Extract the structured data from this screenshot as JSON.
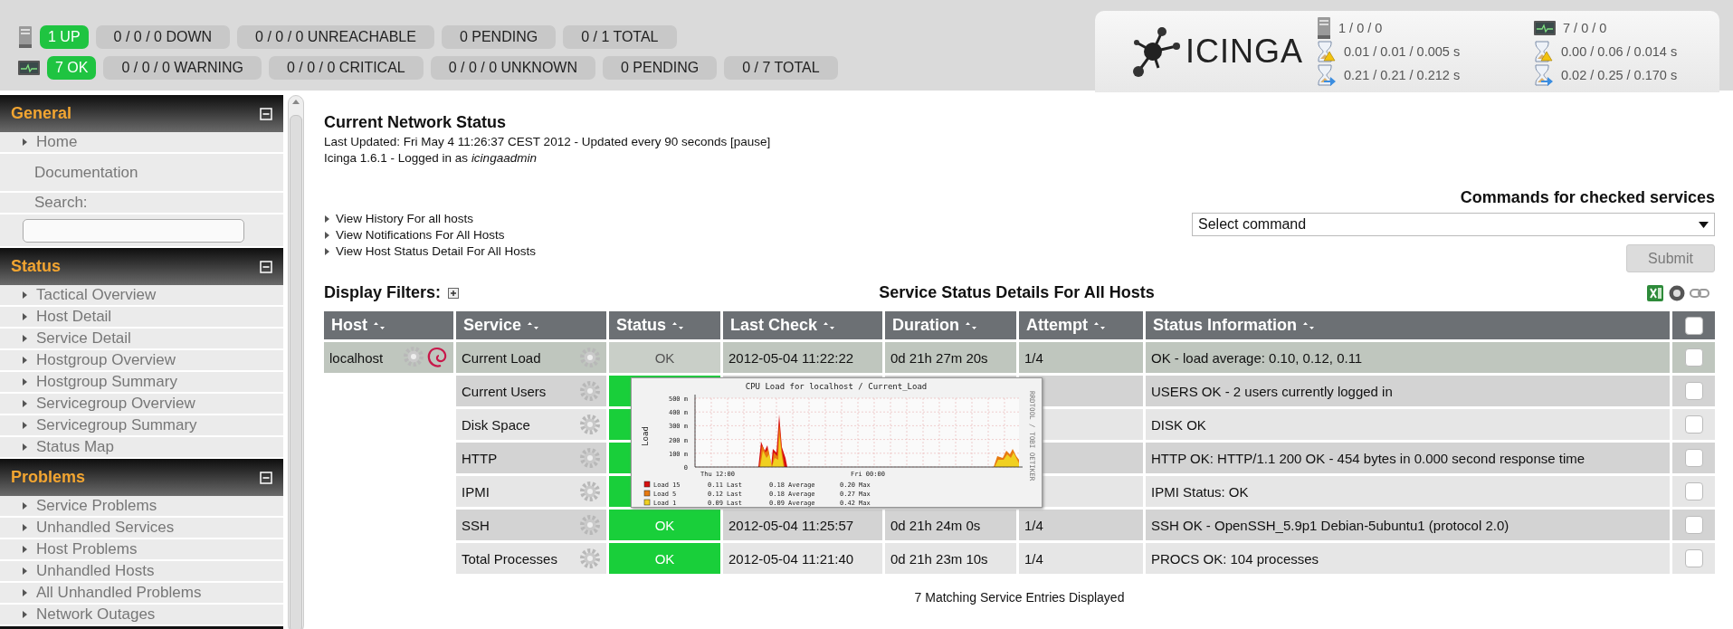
{
  "host_summary": {
    "items": [
      {
        "text": "1 UP",
        "kind": "up"
      },
      {
        "text": "0 / 0 / 0 DOWN",
        "kind": "neutral"
      },
      {
        "text": "0 / 0 / 0 UNREACHABLE",
        "kind": "neutral"
      },
      {
        "text": "0 PENDING",
        "kind": "neutral"
      },
      {
        "text": "0 / 1 TOTAL",
        "kind": "neutral"
      }
    ]
  },
  "service_summary": {
    "items": [
      {
        "text": "7 OK",
        "kind": "up"
      },
      {
        "text": "0 / 0 / 0 WARNING",
        "kind": "neutral"
      },
      {
        "text": "0 / 0 / 0 CRITICAL",
        "kind": "neutral"
      },
      {
        "text": "0 / 0 / 0 UNKNOWN",
        "kind": "neutral"
      },
      {
        "text": "0 PENDING",
        "kind": "neutral"
      },
      {
        "text": "0 / 7 TOTAL",
        "kind": "neutral"
      }
    ]
  },
  "logo": {
    "text": "ICINGA"
  },
  "performance": {
    "hosts": [
      "1 / 0 / 0",
      "0.01 / 0.01 / 0.005 s",
      "0.21 / 0.21 / 0.212 s"
    ],
    "services": [
      "7 / 0 / 0",
      "0.00 / 0.06 / 0.014 s",
      "0.02 / 0.25 / 0.170 s"
    ]
  },
  "sidebar": {
    "sections": [
      {
        "title": "General",
        "items": [
          {
            "label": "Home",
            "kind": "link"
          },
          {
            "label": "Documentation",
            "kind": "plain"
          },
          {
            "label": "Search:",
            "kind": "search"
          }
        ]
      },
      {
        "title": "Status",
        "items": [
          {
            "label": "Tactical Overview",
            "kind": "link"
          },
          {
            "label": "Host Detail",
            "kind": "link"
          },
          {
            "label": "Service Detail",
            "kind": "link"
          },
          {
            "label": "Hostgroup Overview",
            "kind": "link"
          },
          {
            "label": "Hostgroup Summary",
            "kind": "link"
          },
          {
            "label": "Servicegroup Overview",
            "kind": "link"
          },
          {
            "label": "Servicegroup Summary",
            "kind": "link"
          },
          {
            "label": "Status Map",
            "kind": "link"
          }
        ]
      },
      {
        "title": "Problems",
        "items": [
          {
            "label": "Service Problems",
            "kind": "link"
          },
          {
            "label": "Unhandled Services",
            "kind": "link"
          },
          {
            "label": "Host Problems",
            "kind": "link"
          },
          {
            "label": "Unhandled Hosts",
            "kind": "link"
          },
          {
            "label": "All Unhandled Problems",
            "kind": "link"
          },
          {
            "label": "Network Outages",
            "kind": "link"
          }
        ]
      }
    ]
  },
  "header": {
    "title": "Current Network Status",
    "last_updated": "Last Updated: Fri May 4 11:26:37 CEST 2012 - Updated every 90 seconds",
    "pause_link": "[pause]",
    "login": "Icinga 1.6.1 - Logged in as *icingaadmin*"
  },
  "links": [
    "View History For all hosts",
    "View Notifications For All Hosts",
    "View Host Status Detail For All Hosts"
  ],
  "commands": {
    "title": "Commands for checked services",
    "select": "Select command",
    "submit": {
      "label": "Submit",
      "disabled": true
    }
  },
  "filters": {
    "label": "Display Filters:"
  },
  "table": {
    "title": "Service Status Details For All Hosts",
    "columns": [
      "Host",
      "Service",
      "Status",
      "Last Check",
      "Duration",
      "Attempt",
      "Status Information"
    ],
    "header_checked": false,
    "rows": [
      {
        "host": "localhost",
        "service": "Current Load",
        "status": "OK",
        "last_check": "2012-05-04 11:22:22",
        "duration": "0d 21h 27m 20s",
        "attempt": "1/4",
        "info": "OK - load average: 0.10, 0.12, 0.11",
        "checked": false,
        "selected": true
      },
      {
        "service": "Current Users",
        "info": "USERS OK - 2 users currently logged in",
        "checked": false,
        "selected": false
      },
      {
        "service": "Disk Space",
        "info": "DISK OK",
        "checked": false,
        "selected": false
      },
      {
        "service": "HTTP",
        "info": "HTTP OK: HTTP/1.1 200 OK - 454 bytes in 0.000 second response time",
        "checked": false,
        "selected": false
      },
      {
        "service": "IPMI",
        "info": "IPMI Status: OK",
        "checked": false,
        "selected": false
      },
      {
        "service": "SSH",
        "status": "OK",
        "last_check": "2012-05-04 11:25:57",
        "duration": "0d 21h 24m 0s",
        "attempt": "1/4",
        "info": "SSH OK - OpenSSH_5.9p1 Debian-5ubuntu1 (protocol 2.0)",
        "checked": false,
        "selected": false
      },
      {
        "service": "Total Processes",
        "status": "OK",
        "last_check": "2012-05-04 11:21:40",
        "duration": "0d 21h 23m 10s",
        "attempt": "1/4",
        "info": "PROCS OK: 104 processes",
        "checked": false,
        "selected": false
      }
    ],
    "footer": "7 Matching Service Entries Displayed"
  },
  "popup": {
    "title": "CPU Load for localhost / Current_Load",
    "ylabel": "Load",
    "yticks": [
      "500 m",
      "400 m",
      "300 m",
      "200 m",
      "100 m",
      "0"
    ],
    "xticks": [
      "Thu 12:00",
      "Fri 00:00"
    ],
    "side_text": "RRDTOOL / TOBI OETIKER",
    "legend": [
      {
        "label": "Load 15",
        "color": "#d81010",
        "last": "0.11 Last",
        "average": "0.18 Average",
        "max": "0.20 Max"
      },
      {
        "label": "Load 5",
        "color": "#e87a10",
        "last": "0.12 Last",
        "average": "0.18 Average",
        "max": "0.27 Max"
      },
      {
        "label": "Load 1",
        "color": "#f0d020",
        "last": "0.09 Last",
        "average": "0.09 Average",
        "max": "0.42 Max"
      }
    ]
  }
}
